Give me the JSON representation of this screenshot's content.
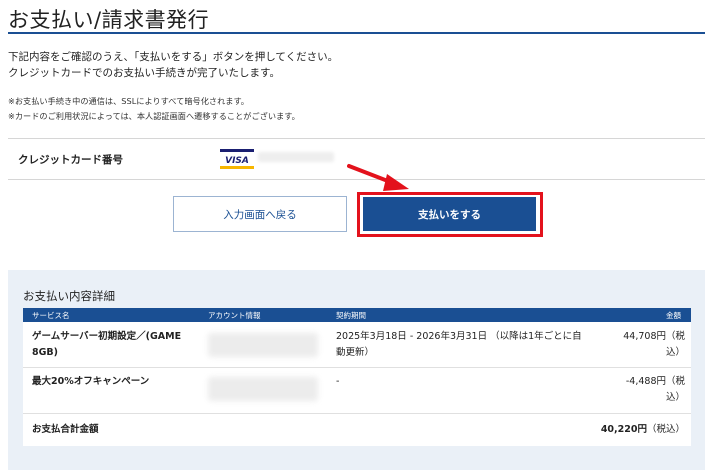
{
  "page": {
    "title": "お支払い/請求書発行",
    "intro_line1": "下記内容をご確認のうえ、「支払いをする」ボタンを押してください。",
    "intro_line2": "クレジットカードでのお支払い手続きが完了いたします。",
    "note1": "※お支払い手続き中の通信は、SSLによりすべて暗号化されます。",
    "note2": "※カードのご利用状況によっては、本人認証画面へ遷移することがございます。"
  },
  "card": {
    "label": "クレジットカード番号",
    "brand_icon": "visa-icon",
    "brand_text": "VISA"
  },
  "buttons": {
    "back_label": "入力画面へ戻る",
    "pay_label": "支払いをする"
  },
  "colors": {
    "brand_blue": "#1a4f93",
    "highlight_red": "#e3121c",
    "panel_bg": "#eaf0f7"
  },
  "details": {
    "title": "お支払い内容詳細",
    "headers": {
      "service": "サービス名",
      "account": "アカウント情報",
      "period": "契約期間",
      "amount": "金額"
    },
    "rows": [
      {
        "service_line1": "ゲームサーバー初期設定／(GAME",
        "service_line2": "8GB)",
        "period_line1": "2025年3月18日 - 2026年3月31日 （以降は1年ごとに自",
        "period_line2": "動更新）",
        "amount_line1": "44,708円（税",
        "amount_line2": "込）"
      },
      {
        "service_line1": "最大20%オフキャンペーン",
        "period_line1": "-",
        "amount_line1": "-4,488円（税",
        "amount_line2": "込）"
      }
    ],
    "total_label": "お支払合計金額",
    "total_value": "40,220円",
    "total_suffix": "（税込）"
  }
}
